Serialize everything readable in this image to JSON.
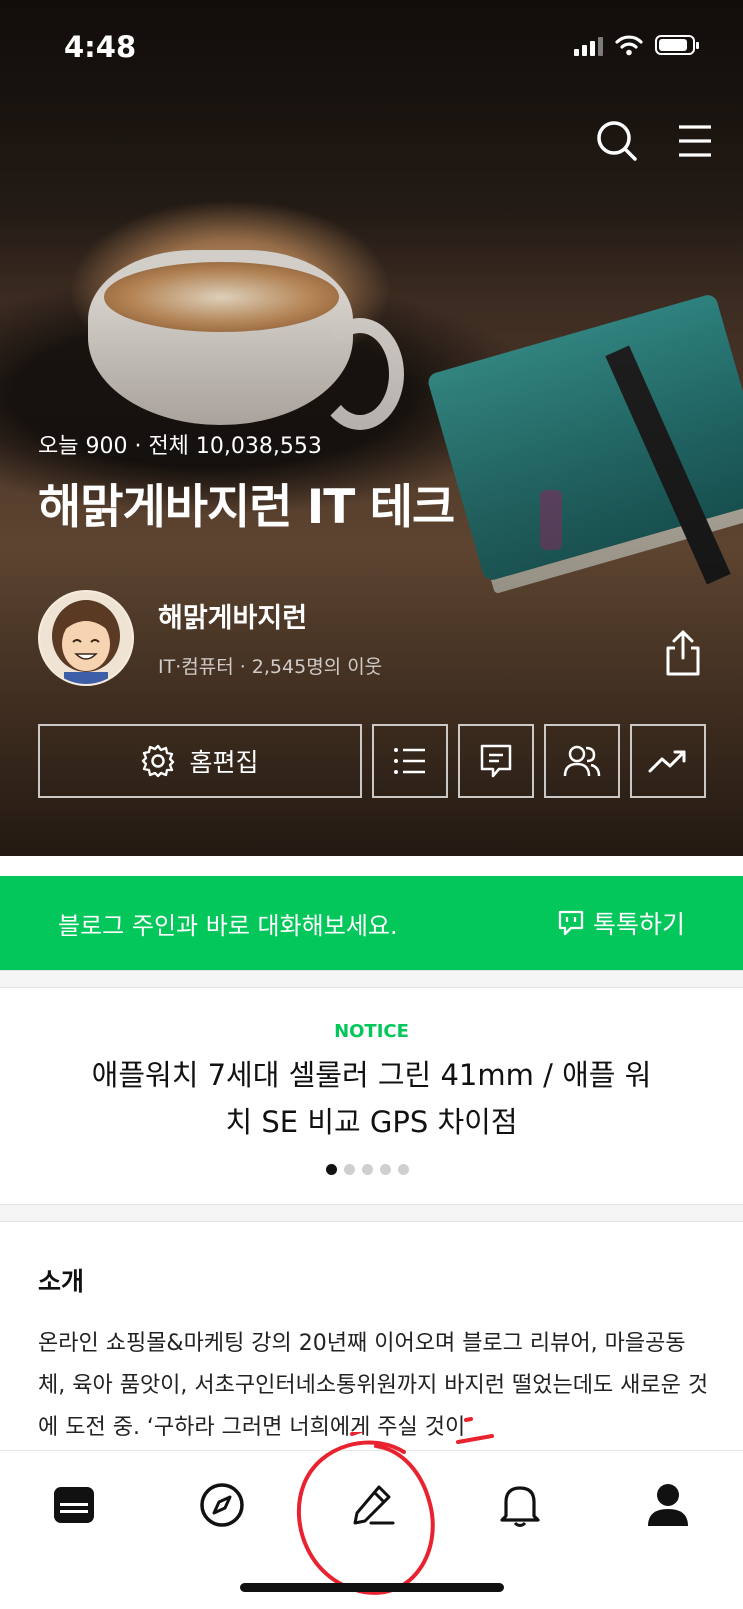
{
  "status_bar": {
    "time": "4:48"
  },
  "header": {
    "icons": [
      "search-icon",
      "menu-icon"
    ]
  },
  "blog": {
    "stats": "오늘 900 · 전체 10,038,553",
    "title": "해맑게바지런 IT 테크",
    "owner_name": "해맑게바지런",
    "owner_meta": "IT·컴퓨터 · 2,545명의 이웃"
  },
  "actions": {
    "edit_label": "홈편집",
    "icons": [
      "list-icon",
      "comment-icon",
      "neighbors-icon",
      "stats-icon"
    ]
  },
  "talk": {
    "text": "블로그 주인과 바로 대화해보세요.",
    "button_label": "톡톡하기"
  },
  "notice": {
    "tag": "NOTICE",
    "title": "애플워치 7세대 셀룰러 그린 41mm / 애플 워치 SE 비교 GPS 차이점",
    "page_count": 5,
    "current_page": 1
  },
  "intro": {
    "heading": "소개",
    "body": "온라인 쇼핑몰&마케팅 강의 20년째 이어오며 블로그 리뷰어, 마을공동체, 육아 품앗이, 서초구인터네소통위원까지 바지런 떨었는데도 새로운 것에 도전 중. ‘구하라 그러면 너희에게 주실 것이"
  },
  "tab_bar": {
    "items": [
      "feed-icon",
      "explore-icon",
      "write-icon",
      "notification-icon",
      "profile-icon"
    ]
  },
  "colors": {
    "accent_green": "#03c75a",
    "annotation_red": "#e8222e"
  }
}
